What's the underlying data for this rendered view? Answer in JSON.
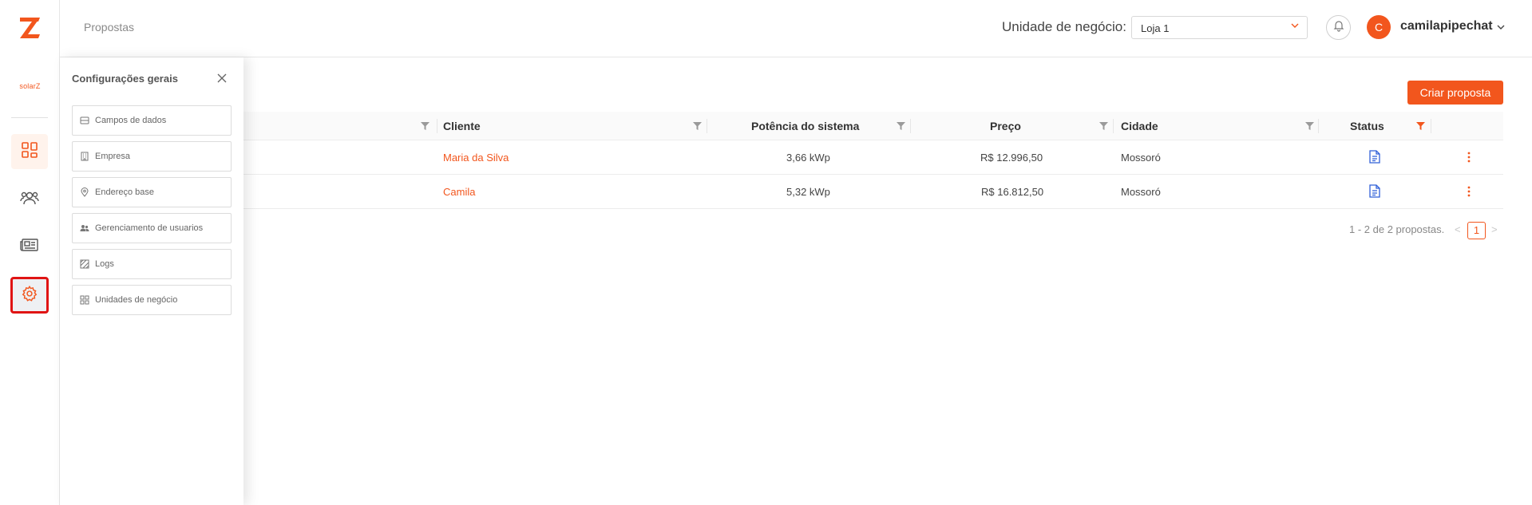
{
  "brand": {
    "accent": "#f2561d",
    "solar_logo_text": "solarZ"
  },
  "header": {
    "breadcrumb": "Propostas",
    "business_unit_label": "Unidade de negócio:",
    "business_unit_value": "Loja 1",
    "user_initial": "C",
    "username": "camilapipechat"
  },
  "rail": {
    "items": [
      {
        "name": "dashboard-icon",
        "active": true
      },
      {
        "name": "users-icon",
        "active": false
      },
      {
        "name": "newspaper-icon",
        "active": false
      },
      {
        "name": "gear-icon",
        "active": true,
        "highlighted": true
      }
    ]
  },
  "drawer": {
    "title": "Configurações gerais",
    "items": [
      {
        "label": "Campos de dados",
        "icon": "database-icon"
      },
      {
        "label": "Empresa",
        "icon": "building-icon"
      },
      {
        "label": "Endereço base",
        "icon": "location-pin-icon"
      },
      {
        "label": "Gerenciamento de usuarios",
        "icon": "users-icon"
      },
      {
        "label": "Logs",
        "icon": "logs-icon"
      },
      {
        "label": "Unidades de negócio",
        "icon": "grid-icon"
      }
    ]
  },
  "main": {
    "create_button": "Criar proposta",
    "columns": {
      "cliente": "Cliente",
      "potencia": "Potência do sistema",
      "preco": "Preço",
      "cidade": "Cidade",
      "status": "Status"
    },
    "rows": [
      {
        "cliente": "Maria da Silva",
        "potencia": "3,66 kWp",
        "preco": "R$ 12.996,50",
        "cidade": "Mossoró",
        "status": "document-icon"
      },
      {
        "cliente": "Camila",
        "potencia": "5,32 kWp",
        "preco": "R$ 16.812,50",
        "cidade": "Mossoró",
        "status": "document-icon"
      }
    ],
    "pagination": {
      "summary": "1 - 2 de 2 propostas.",
      "prev": "<",
      "current": "1",
      "next": ">"
    }
  }
}
